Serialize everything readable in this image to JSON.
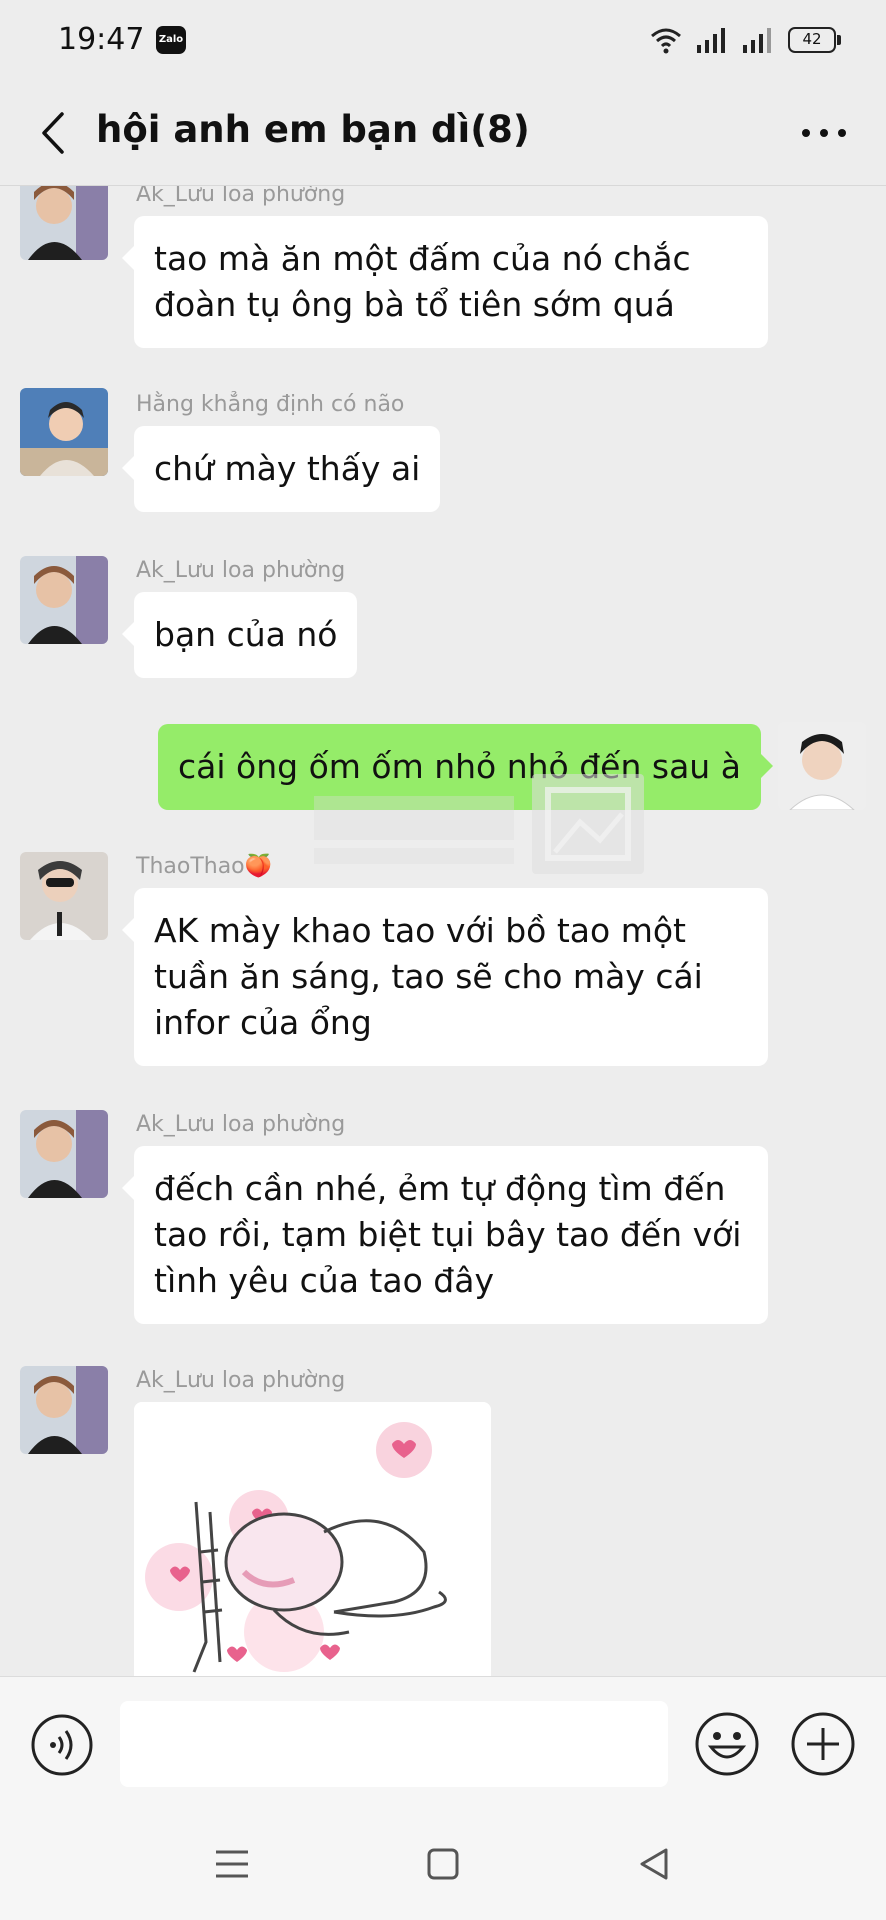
{
  "status": {
    "time": "19:47",
    "app_badge": "Zalo",
    "battery": "42"
  },
  "header": {
    "title": "hội anh em bạn dì(8)"
  },
  "messages": [
    {
      "sender": "Ak_Lưu loa phường",
      "text": "tao mà ăn một đấm của nó chắc đoàn tụ ông bà tổ tiên sớm quá"
    },
    {
      "sender": "Hằng khẳng định có não",
      "text": "chứ mày thấy ai"
    },
    {
      "sender": "Ak_Lưu loa phường",
      "text": "bạn của nó"
    },
    {
      "sender": "",
      "text": "cái ông ốm ốm nhỏ nhỏ đến sau à"
    },
    {
      "sender": "ThaoThao🍑",
      "text": "AK mày khao tao với bồ tao  một tuần ăn sáng, tao sẽ cho mày cái infor của ổng"
    },
    {
      "sender": "Ak_Lưu loa phường",
      "text": "đếch cần nhé, ẻm tự động tìm đến tao rồi, tạm biệt tụi bây tao đến với tình yêu của tao đây"
    },
    {
      "sender": "Ak_Lưu loa phường",
      "text": ""
    }
  ],
  "input": {
    "placeholder": ""
  },
  "colors": {
    "background": "#ededed",
    "my_bubble": "#95ec69",
    "other_bubble": "#ffffff"
  }
}
